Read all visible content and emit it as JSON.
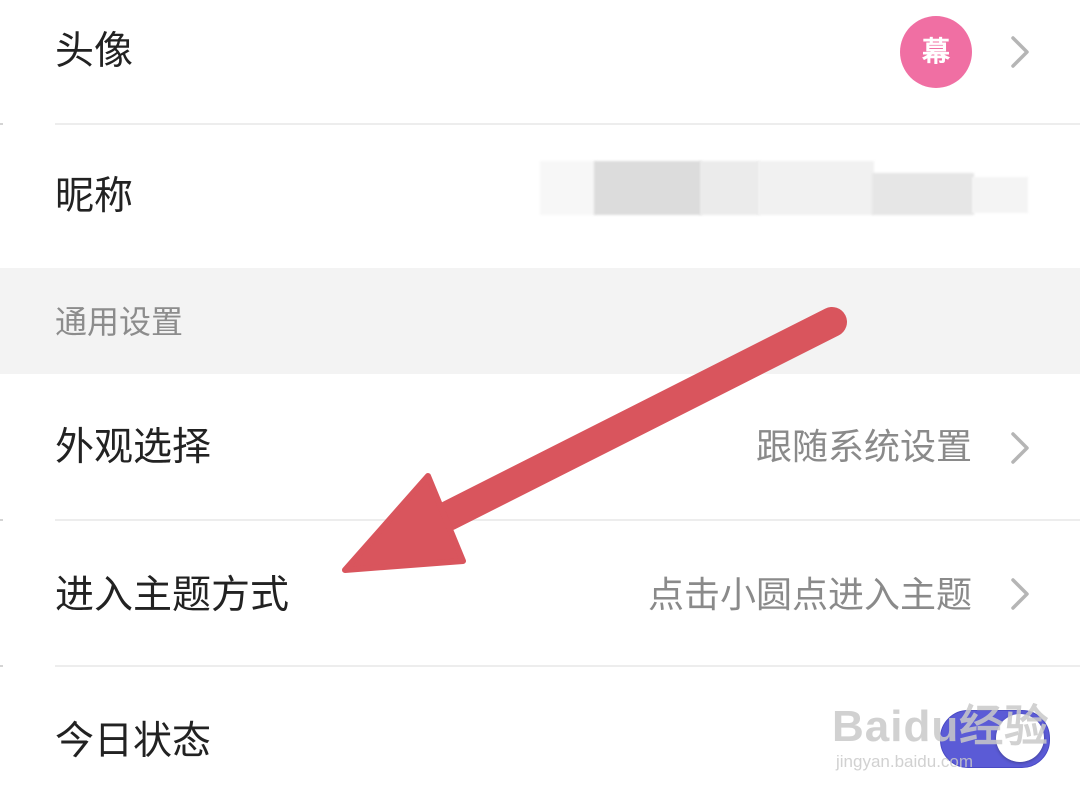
{
  "profile": {
    "avatar": {
      "label": "头像",
      "badge_text": "幕",
      "badge_color": "#f06fa3"
    },
    "nickname": {
      "label": "昵称"
    }
  },
  "general_settings": {
    "title": "通用设置",
    "appearance": {
      "label": "外观选择",
      "value": "跟随系统设置"
    },
    "theme_entry": {
      "label": "进入主题方式",
      "value": "点击小圆点进入主题"
    },
    "today_status": {
      "label": "今日状态",
      "toggle_on": true,
      "toggle_color": "#5b5bd6"
    }
  },
  "watermark": {
    "brand": "Baidu经验",
    "url": "jingyan.baidu.com"
  },
  "annotation": {
    "arrow_color": "#d9555d",
    "icon": "red-arrow-annotation"
  },
  "icons": {
    "chevron": "chevron-right-icon"
  }
}
